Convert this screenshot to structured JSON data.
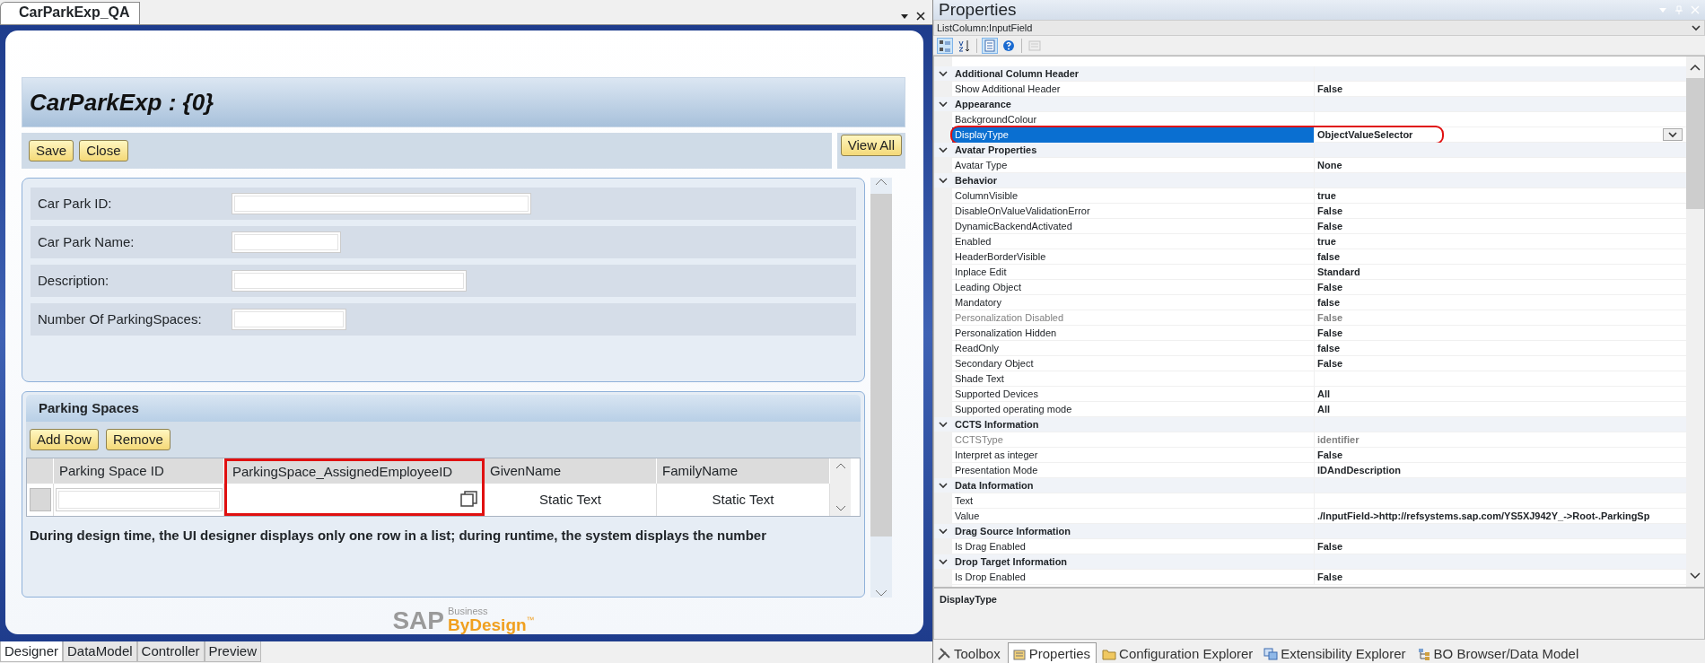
{
  "designer": {
    "tab": "CarParkExp_QA",
    "title": "CarParkExp : {0}",
    "buttons": [
      "Save",
      "Close"
    ],
    "view_all": "View All",
    "fields": [
      {
        "label": "Car Park ID:"
      },
      {
        "label": "Car Park Name:"
      },
      {
        "label": "Description:"
      },
      {
        "label": "Number Of ParkingSpaces:"
      }
    ],
    "section": {
      "title": "Parking Spaces",
      "buttons": [
        "Add Row",
        "Remove"
      ],
      "columns": [
        {
          "label": "Parking Space ID",
          "circled": false
        },
        {
          "label": "ParkingSpace_AssignedEmployeeID",
          "circled": true
        },
        {
          "label": "GivenName",
          "circled": false
        },
        {
          "label": "FamilyName",
          "circled": false
        }
      ],
      "row": [
        {
          "kind": "input"
        },
        {
          "kind": "selector"
        },
        {
          "kind": "text",
          "text": "Static Text"
        },
        {
          "kind": "text",
          "text": "Static Text"
        }
      ]
    },
    "note": "During design time, the UI designer displays only one row in a list; during runtime, the system displays the number",
    "logo": {
      "mark": "SAP",
      "tagline": "Business",
      "product": "ByDesign",
      "tm": "™"
    },
    "view_tabs": [
      {
        "label": "Designer",
        "selected": true
      },
      {
        "label": "DataModel",
        "selected": false
      },
      {
        "label": "Controller",
        "selected": false
      },
      {
        "label": "Preview",
        "selected": false
      }
    ]
  },
  "properties": {
    "title": "Properties",
    "object": "ListColumn:InputField",
    "toolbar": [
      {
        "kind": "categorized",
        "selected": true,
        "disabled": false
      },
      {
        "kind": "alphabetical",
        "selected": false,
        "disabled": false
      },
      {
        "kind": "pages",
        "selected": true,
        "disabled": false
      },
      {
        "kind": "help",
        "selected": false,
        "disabled": false
      },
      {
        "kind": "page-setup",
        "selected": false,
        "disabled": true
      }
    ],
    "rows": [
      {
        "kind": "section",
        "name": "Additional Column Header",
        "expanded": true
      },
      {
        "kind": "prop",
        "name": "Show Additional Header",
        "value": "False",
        "disabled": false,
        "selected": false,
        "circled": false
      },
      {
        "kind": "section",
        "name": "Appearance",
        "expanded": true
      },
      {
        "kind": "prop",
        "name": "BackgroundColour",
        "disabled": false,
        "selected": false,
        "circled": false
      },
      {
        "kind": "prop",
        "name": "DisplayType",
        "value": "ObjectValueSelector",
        "disabled": false,
        "selected": true,
        "circled": true
      },
      {
        "kind": "section",
        "name": "Avatar Properties",
        "expanded": true
      },
      {
        "kind": "prop",
        "name": "Avatar Type",
        "value": "None",
        "disabled": false,
        "selected": false,
        "circled": false
      },
      {
        "kind": "section",
        "name": "Behavior",
        "expanded": true
      },
      {
        "kind": "prop",
        "name": "ColumnVisible",
        "value": "true",
        "disabled": false,
        "selected": false,
        "circled": false
      },
      {
        "kind": "prop",
        "name": "DisableOnValueValidationError",
        "value": "False",
        "disabled": false,
        "selected": false,
        "circled": false
      },
      {
        "kind": "prop",
        "name": "DynamicBackendActivated",
        "value": "False",
        "disabled": false,
        "selected": false,
        "circled": false
      },
      {
        "kind": "prop",
        "name": "Enabled",
        "value": "true",
        "disabled": false,
        "selected": false,
        "circled": false
      },
      {
        "kind": "prop",
        "name": "HeaderBorderVisible",
        "value": "false",
        "disabled": false,
        "selected": false,
        "circled": false
      },
      {
        "kind": "prop",
        "name": "Inplace Edit",
        "value": "Standard",
        "disabled": false,
        "selected": false,
        "circled": false
      },
      {
        "kind": "prop",
        "name": "Leading Object",
        "value": "False",
        "disabled": false,
        "selected": false,
        "circled": false
      },
      {
        "kind": "prop",
        "name": "Mandatory",
        "value": "false",
        "disabled": false,
        "selected": false,
        "circled": false
      },
      {
        "kind": "prop",
        "name": "Personalization Disabled",
        "value": "False",
        "disabled": true,
        "selected": false,
        "circled": false
      },
      {
        "kind": "prop",
        "name": "Personalization Hidden",
        "value": "False",
        "disabled": false,
        "selected": false,
        "circled": false
      },
      {
        "kind": "prop",
        "name": "ReadOnly",
        "value": "false",
        "disabled": false,
        "selected": false,
        "circled": false
      },
      {
        "kind": "prop",
        "name": "Secondary Object",
        "value": "False",
        "disabled": false,
        "selected": false,
        "circled": false
      },
      {
        "kind": "prop",
        "name": "Shade Text",
        "disabled": false,
        "selected": false,
        "circled": false
      },
      {
        "kind": "prop",
        "name": "Supported Devices",
        "value": "All",
        "disabled": false,
        "selected": false,
        "circled": false
      },
      {
        "kind": "prop",
        "name": "Supported operating mode",
        "value": "All",
        "disabled": false,
        "selected": false,
        "circled": false
      },
      {
        "kind": "section",
        "name": "CCTS Information",
        "expanded": true
      },
      {
        "kind": "prop",
        "name": "CCTSType",
        "value": "identifier",
        "disabled": true,
        "selected": false,
        "circled": false
      },
      {
        "kind": "prop",
        "name": "Interpret as integer",
        "value": "False",
        "disabled": false,
        "selected": false,
        "circled": false
      },
      {
        "kind": "prop",
        "name": "Presentation Mode",
        "value": "IDAndDescription",
        "disabled": false,
        "selected": false,
        "circled": false
      },
      {
        "kind": "section",
        "name": "Data Information",
        "expanded": true
      },
      {
        "kind": "prop",
        "name": "Text",
        "disabled": false,
        "selected": false,
        "circled": false
      },
      {
        "kind": "prop",
        "name": "Value",
        "value": "./InputField->http://refsystems.sap.com/YS5XJ942Y_->Root-.ParkingSp",
        "disabled": false,
        "selected": false,
        "circled": false
      },
      {
        "kind": "section",
        "name": "Drag Source Information",
        "expanded": true
      },
      {
        "kind": "prop",
        "name": "Is Drag Enabled",
        "value": "False",
        "disabled": false,
        "selected": false,
        "circled": false
      },
      {
        "kind": "section",
        "name": "Drop Target Information",
        "expanded": true
      },
      {
        "kind": "prop",
        "name": "Is Drop Enabled",
        "value": "False",
        "disabled": false,
        "selected": false,
        "circled": false
      }
    ],
    "description": "DisplayType",
    "tabs": [
      {
        "label": "Toolbox",
        "selected": false
      },
      {
        "label": "Properties",
        "selected": true
      },
      {
        "label": "Configuration Explorer",
        "selected": false
      },
      {
        "label": "Extensibility Explorer",
        "selected": false
      },
      {
        "label": "BO Browser/Data Model",
        "selected": false
      }
    ]
  }
}
